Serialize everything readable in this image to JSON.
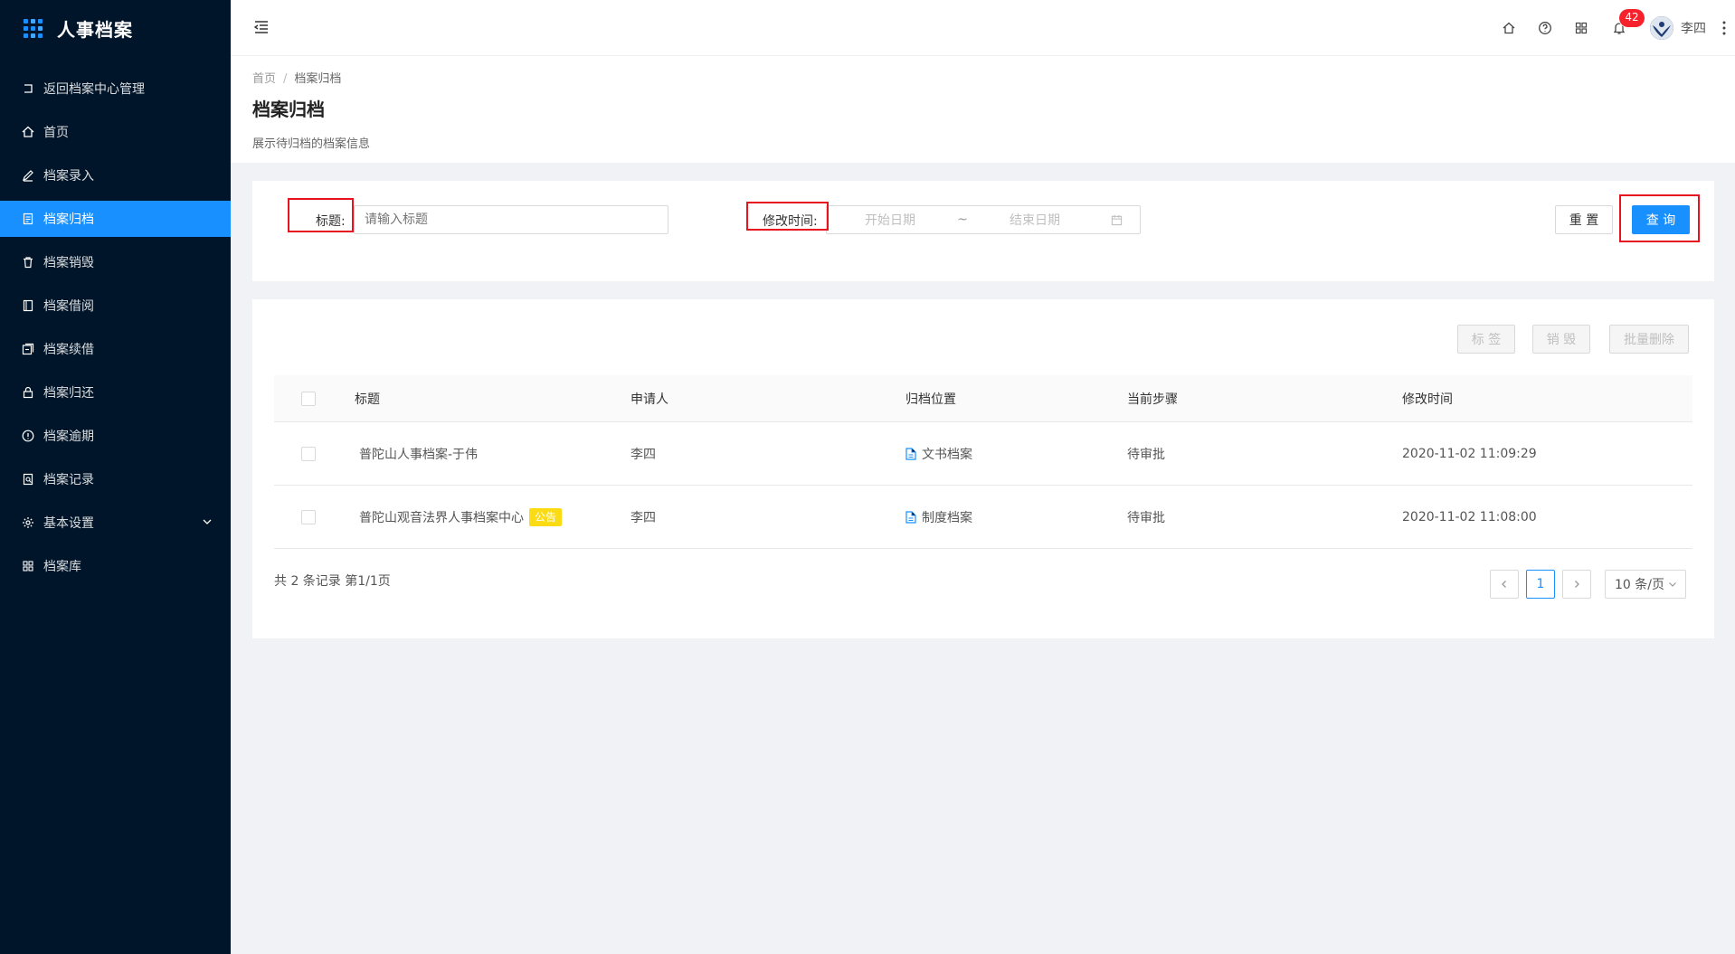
{
  "app": {
    "title": "人事档案"
  },
  "sidebar": {
    "items": [
      {
        "label": "返回档案中心管理",
        "icon": "return-icon"
      },
      {
        "label": "首页",
        "icon": "home-icon"
      },
      {
        "label": "档案录入",
        "icon": "edit-icon"
      },
      {
        "label": "档案归档",
        "icon": "archive-icon",
        "active": true
      },
      {
        "label": "档案销毁",
        "icon": "trash-icon"
      },
      {
        "label": "档案借阅",
        "icon": "book-icon"
      },
      {
        "label": "档案续借",
        "icon": "renew-icon"
      },
      {
        "label": "档案归还",
        "icon": "lock-icon"
      },
      {
        "label": "档案逾期",
        "icon": "info-icon"
      },
      {
        "label": "档案记录",
        "icon": "record-icon"
      },
      {
        "label": "基本设置",
        "icon": "gear-icon"
      },
      {
        "label": "档案库",
        "icon": "grid-icon"
      }
    ]
  },
  "header": {
    "notification_count": "42",
    "user_name": "李四"
  },
  "page": {
    "breadcrumb_home": "首页",
    "breadcrumb_sep": "/",
    "breadcrumb_current": "档案归档",
    "title": "档案归档",
    "description": "展示待归档的档案信息"
  },
  "search": {
    "title_label": "标题:",
    "title_placeholder": "请输入标题",
    "time_label": "修改时间:",
    "start_placeholder": "开始日期",
    "range_sep": "~",
    "end_placeholder": "结束日期",
    "reset_label": "重 置",
    "query_label": "查 询"
  },
  "toolbar": {
    "tag_label": "标 签",
    "destroy_label": "销 毁",
    "batch_delete_label": "批量删除"
  },
  "table": {
    "columns": [
      "标题",
      "申请人",
      "归档位置",
      "当前步骤",
      "修改时间"
    ],
    "rows": [
      {
        "title": "普陀山人事档案-于伟",
        "tag": "",
        "applicant": "李四",
        "location": "文书档案",
        "step": "待审批",
        "modified": "2020-11-02 11:09:29"
      },
      {
        "title": "普陀山观音法界人事档案中心",
        "tag": "公告",
        "applicant": "李四",
        "location": "制度档案",
        "step": "待审批",
        "modified": "2020-11-02 11:08:00"
      }
    ]
  },
  "pagination": {
    "summary": "共 2 条记录 第1/1页",
    "current_page": "1",
    "page_size": "10 条/页"
  },
  "colors": {
    "sidebar_bg": "#001529",
    "accent": "#1890ff",
    "highlight_box": "#e6141e",
    "tag_yellow": "#fadb14"
  }
}
